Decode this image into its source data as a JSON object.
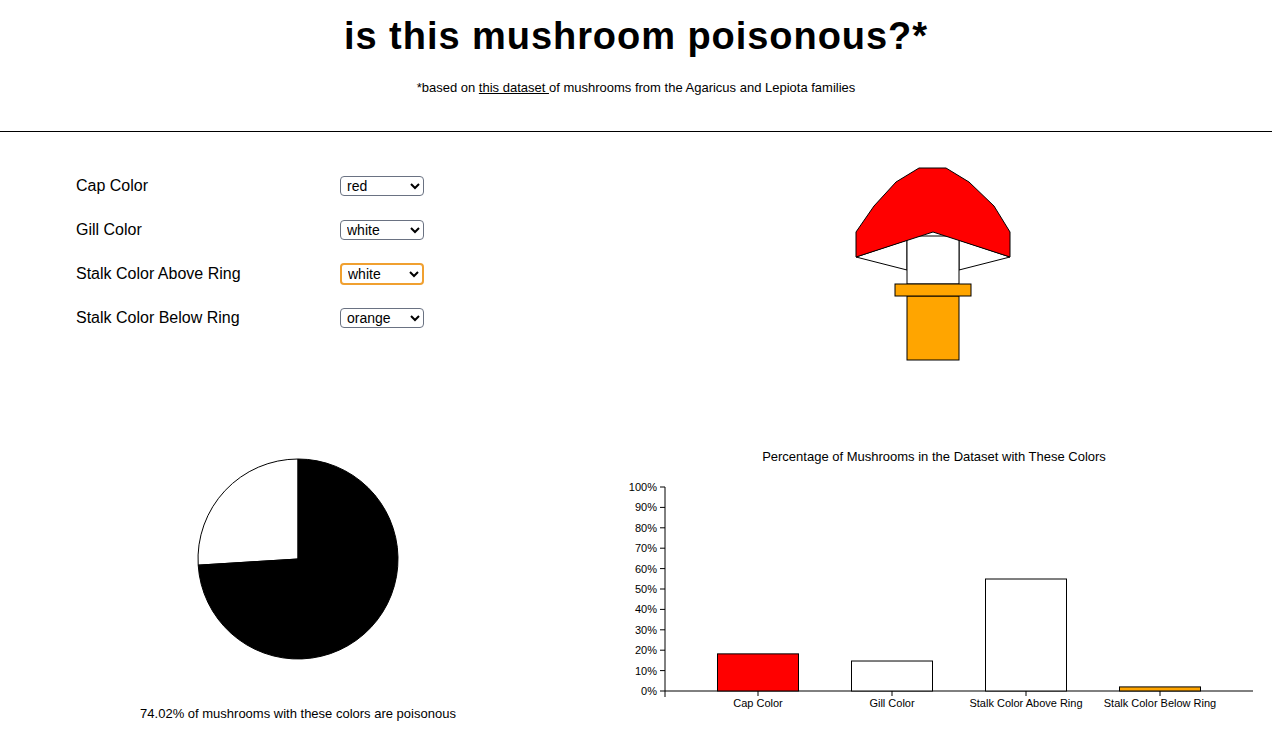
{
  "header": {
    "title": "is this mushroom poisonous?*",
    "note_prefix": "*based on ",
    "note_link": "this dataset ",
    "note_suffix": "of mushrooms from the Agaricus and Lepiota families"
  },
  "controls": [
    {
      "label": "Cap Color",
      "value": "red",
      "focused": false
    },
    {
      "label": "Gill Color",
      "value": "white",
      "focused": false
    },
    {
      "label": "Stalk Color Above Ring",
      "value": "white",
      "focused": true
    },
    {
      "label": "Stalk Color Below Ring",
      "value": "orange",
      "focused": false
    }
  ],
  "pie": {
    "poisonous_level": 0.7402,
    "caption": "74.02% of mushrooms with these colors are poisonous"
  },
  "bar_chart": {
    "title": "Percentage of Mushrooms in the Dataset with These Colors",
    "ticks": [
      "0%",
      "10%",
      "20%",
      "30%",
      "40%",
      "50%",
      "60%",
      "70%",
      "80%",
      "90%",
      "100%"
    ],
    "bars": [
      {
        "label": "Cap Color",
        "value": 18.2,
        "color": "#ff0000"
      },
      {
        "label": "Gill Color",
        "value": 14.7,
        "color": "#ffffff"
      },
      {
        "label": "Stalk Color Above Ring",
        "value": 54.9,
        "color": "#ffffff"
      },
      {
        "label": "Stalk Color Below Ring",
        "value": 2.0,
        "color": "#ffa500"
      }
    ]
  }
}
